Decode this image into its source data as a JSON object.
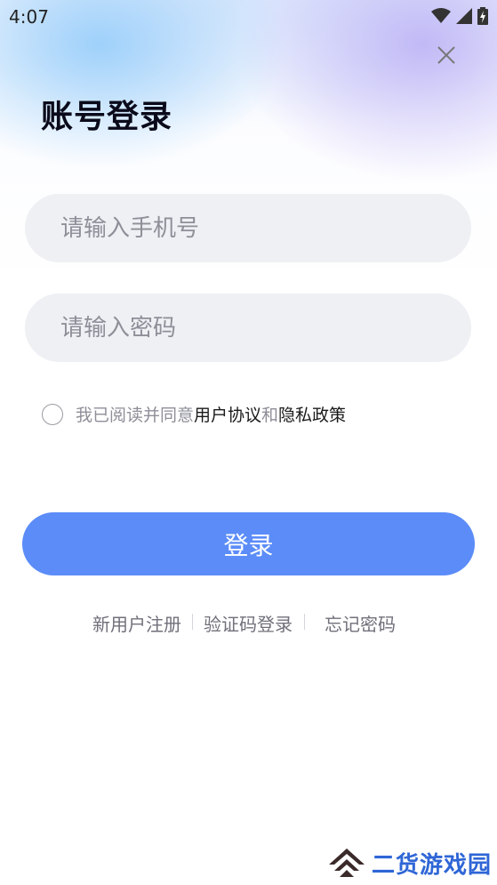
{
  "status_bar": {
    "time": "4:07"
  },
  "header": {
    "title": "账号登录",
    "close_icon": "close-icon"
  },
  "form": {
    "phone_placeholder": "请输入手机号",
    "password_placeholder": "请输入密码",
    "agreement": {
      "prefix": "我已阅读并同意",
      "user_agreement": "用户协议",
      "and": "和",
      "privacy_policy": "隐私政策",
      "checked": false
    },
    "login_label": "登录"
  },
  "footer_links": {
    "register": "新用户注册",
    "sms_login": "验证码登录",
    "forgot_password": "忘记密码"
  },
  "watermark": {
    "text": "二货游戏园"
  },
  "colors": {
    "primary": "#5b8cf8",
    "title": "#0a0a1a",
    "placeholder": "#8e8f98",
    "watermark": "#2f66d6"
  }
}
